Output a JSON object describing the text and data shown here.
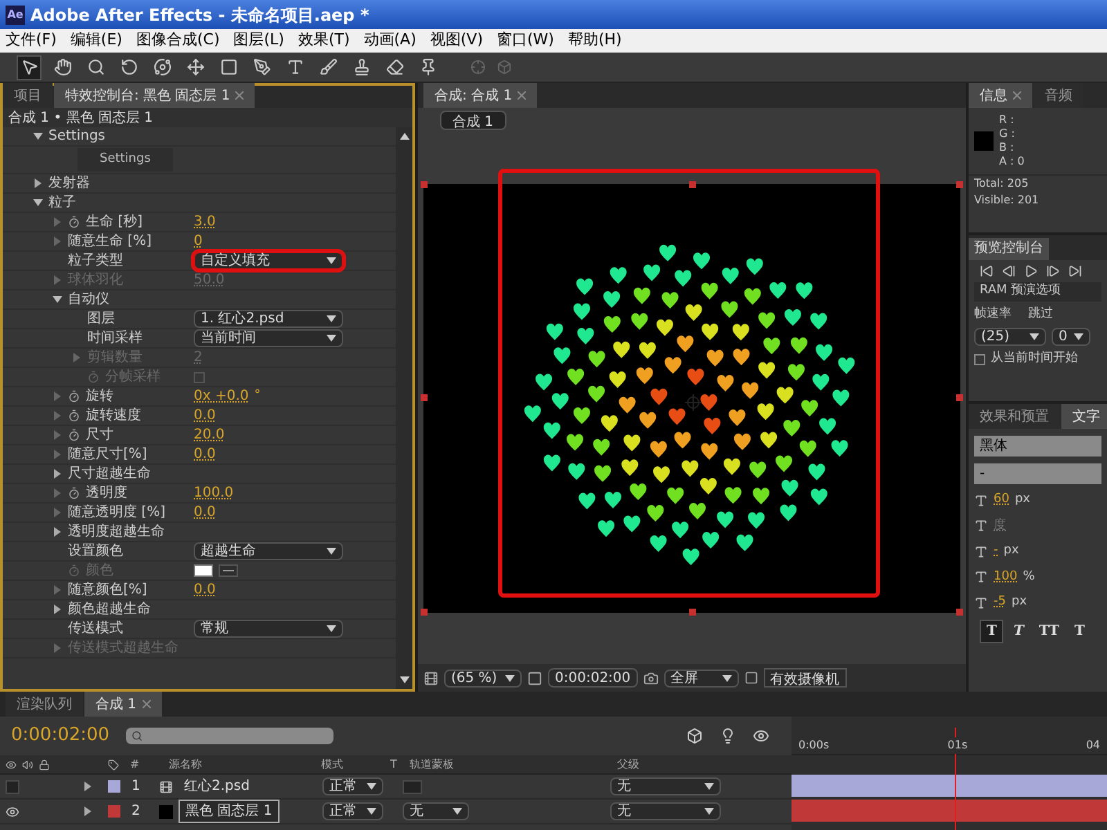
{
  "window": {
    "app_icon": "Ae",
    "title": "Adobe After Effects - 未命名项目.aep *"
  },
  "menu": [
    "文件(F)",
    "编辑(E)",
    "图像合成(C)",
    "图层(L)",
    "效果(T)",
    "动画(A)",
    "视图(V)",
    "窗口(W)",
    "帮助(H)"
  ],
  "tools": [
    {
      "kind": "select",
      "selected": true
    },
    {
      "kind": "hand",
      "selected": false
    },
    {
      "kind": "zoom",
      "selected": false
    },
    {
      "kind": "rotate",
      "selected": false
    },
    {
      "kind": "orbit",
      "selected": false
    },
    {
      "kind": "pan",
      "selected": false
    },
    {
      "kind": "rectangle",
      "selected": false
    },
    {
      "kind": "pen",
      "selected": false
    },
    {
      "kind": "text",
      "selected": false
    },
    {
      "kind": "brush",
      "selected": false
    },
    {
      "kind": "stamp",
      "selected": false
    },
    {
      "kind": "eraser",
      "selected": false
    },
    {
      "kind": "pin",
      "selected": false
    }
  ],
  "effect_controls": {
    "tabs": [
      {
        "label": "项目",
        "selected": false
      },
      {
        "label": "特效控制台: 黑色 固态层 1",
        "selected": true
      }
    ],
    "header": "合成 1 • 黑色 固态层 1",
    "properties": [
      {
        "label": "Settings",
        "kind": "group",
        "expanded": true,
        "disabled": false,
        "children": [
          {
            "label": "Settings",
            "kind": "button"
          }
        ]
      },
      {
        "label": "发射器",
        "kind": "group",
        "expanded": false,
        "disabled": false
      },
      {
        "label": "粒子",
        "kind": "group",
        "expanded": true,
        "disabled": false,
        "children": [
          {
            "label": "生命 [秒]",
            "kind": "value",
            "stopwatch": true,
            "value": "3.0",
            "disabled": false
          },
          {
            "label": "随意生命 [%]",
            "kind": "value",
            "value": "0",
            "disabled": false
          },
          {
            "label": "粒子类型",
            "kind": "dropdown",
            "value": "自定义填充",
            "highlighted": true,
            "disabled": false
          },
          {
            "label": "球体羽化",
            "kind": "value",
            "value": "50.0",
            "disabled": true
          },
          {
            "label": "自动仪",
            "kind": "group",
            "expanded": true,
            "disabled": false,
            "children": [
              {
                "label": "图层",
                "kind": "dropdown",
                "value": "1. 红心2.psd",
                "highlighted": false,
                "disabled": false
              },
              {
                "label": "时间采样",
                "kind": "dropdown",
                "value": "当前时间",
                "highlighted": false,
                "disabled": false
              },
              {
                "label": "剪辑数量",
                "kind": "value",
                "value": "2",
                "disabled": true
              },
              {
                "label": "分帧采样",
                "kind": "check",
                "stopwatch": true,
                "checked": false,
                "disabled": true
              }
            ]
          },
          {
            "label": "旋转",
            "kind": "value",
            "stopwatch": true,
            "value": "0x +0.0",
            "unit": "°",
            "disabled": false
          },
          {
            "label": "旋转速度",
            "kind": "value",
            "stopwatch": true,
            "value": "0.0",
            "disabled": false
          },
          {
            "label": "尺寸",
            "kind": "value",
            "stopwatch": true,
            "value": "20.0",
            "disabled": false
          },
          {
            "label": "随意尺寸[%]",
            "kind": "value",
            "value": "0.0",
            "disabled": false
          },
          {
            "label": "尺寸超越生命",
            "kind": "group",
            "expanded": false,
            "disabled": false
          },
          {
            "label": "透明度",
            "kind": "value",
            "stopwatch": true,
            "value": "100.0",
            "disabled": false
          },
          {
            "label": "随意透明度 [%]",
            "kind": "value",
            "value": "0.0",
            "disabled": false
          },
          {
            "label": "透明度超越生命",
            "kind": "group",
            "expanded": false,
            "disabled": false
          },
          {
            "label": "设置颜色",
            "kind": "dropdown",
            "value": "超越生命",
            "highlighted": false,
            "disabled": false
          },
          {
            "label": "颜色",
            "kind": "swatch",
            "stopwatch": true,
            "color": "#ffffff",
            "disabled": true
          },
          {
            "label": "随意颜色[%]",
            "kind": "value",
            "value": "0.0",
            "disabled": false
          },
          {
            "label": "颜色超越生命",
            "kind": "group",
            "expanded": false,
            "disabled": false
          },
          {
            "label": "传送模式",
            "kind": "dropdown",
            "value": "常规",
            "highlighted": false,
            "disabled": false
          },
          {
            "label": "传送模式超越生命",
            "kind": "group",
            "expanded": false,
            "disabled": true
          }
        ]
      }
    ]
  },
  "composition": {
    "tabs": [
      {
        "label": "合成: 合成 1",
        "selected": true
      }
    ],
    "breadcrumb": "合成 1",
    "highlighted": true,
    "zoom": "(65 %)",
    "time": "0:00:02:00",
    "resolution": "全屏",
    "camera": "有效摄像机"
  },
  "info": {
    "tabs": [
      {
        "label": "信息",
        "selected": true
      },
      {
        "label": "音频",
        "selected": false
      }
    ],
    "channels": [
      "R :",
      "G :",
      "B :",
      "A : 0"
    ],
    "total": "Total: 205",
    "visible": "Visible: 201"
  },
  "preview": {
    "tab": "预览控制台",
    "ram_options": "RAM 预演选项",
    "frame_rate_label": "帧速率",
    "skip_label": "跳过",
    "frame_rate": "(25)",
    "skip": "0",
    "from_current": {
      "label": "从当前时间开始",
      "checked": false
    }
  },
  "character": {
    "tabs": [
      {
        "label": "效果和预置",
        "selected": false
      },
      {
        "label": "文字",
        "selected": true
      }
    ],
    "font": "黑体",
    "style": "-",
    "size": "60",
    "size_unit": "px",
    "kerning": "度",
    "leading": "-",
    "leading_unit": "px",
    "vscale": "100",
    "vscale_unit": "%",
    "baseline": "-5",
    "baseline_unit": "px",
    "styles": [
      {
        "label": "T",
        "selected": true
      },
      {
        "label": "T",
        "selected": false
      },
      {
        "label": "TT",
        "selected": false
      },
      {
        "label": "T",
        "selected": false
      }
    ]
  },
  "timeline": {
    "tabs": [
      {
        "label": "渲染队列",
        "selected": false
      },
      {
        "label": "合成 1",
        "selected": true
      }
    ],
    "time": "0:00:02:00",
    "columns": {
      "number": "#",
      "source": "源名称",
      "mode": "模式",
      "t": "T",
      "matte": "轨道蒙板",
      "parent": "父级"
    },
    "ruler": [
      "0:00s",
      "01s",
      "04"
    ],
    "layers": [
      {
        "number": "1",
        "name": "红心2.psd",
        "kind": "footage",
        "color": "#a8a8d8",
        "visible": false,
        "selected": false,
        "mode": "正常",
        "parent": "无"
      },
      {
        "number": "2",
        "name": "黑色 固态层 1",
        "kind": "solid",
        "color": "#c03838",
        "visible": true,
        "selected": true,
        "mode": "正常",
        "matte": "无",
        "parent": "无"
      }
    ]
  }
}
